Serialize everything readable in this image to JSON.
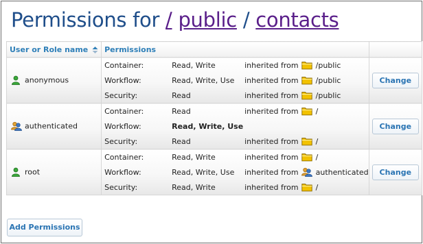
{
  "header": {
    "title_prefix": "Permissions for",
    "separator": "/",
    "crumbs": [
      "public",
      "contacts"
    ]
  },
  "table": {
    "columns": [
      "User or Role name",
      "Permissions",
      ""
    ],
    "sort_icon": "sort-arrows-icon",
    "rows": [
      {
        "user": "anonymous",
        "user_icon": "user-icon",
        "permissions": [
          {
            "kind": "Container:",
            "value": "Read, Write",
            "bold": false,
            "inherited_label": "inherited from",
            "source_icon": "folder-icon",
            "source": "/public"
          },
          {
            "kind": "Workflow:",
            "value": "Read, Write, Use",
            "bold": false,
            "inherited_label": "inherited from",
            "source_icon": "folder-icon",
            "source": "/public"
          },
          {
            "kind": "Security:",
            "value": "Read",
            "bold": false,
            "inherited_label": "inherited from",
            "source_icon": "folder-icon",
            "source": "/public"
          }
        ],
        "action": "Change"
      },
      {
        "user": "authenticated",
        "user_icon": "group-icon",
        "permissions": [
          {
            "kind": "Container:",
            "value": "Read",
            "bold": false,
            "inherited_label": "inherited from",
            "source_icon": "folder-icon",
            "source": "/"
          },
          {
            "kind": "Workflow:",
            "value": "Read, Write, Use",
            "bold": true,
            "inherited_label": "",
            "source_icon": "",
            "source": ""
          },
          {
            "kind": "Security:",
            "value": "Read",
            "bold": false,
            "inherited_label": "inherited from",
            "source_icon": "folder-icon",
            "source": "/"
          }
        ],
        "action": "Change"
      },
      {
        "user": "root",
        "user_icon": "user-icon",
        "permissions": [
          {
            "kind": "Container:",
            "value": "Read, Write",
            "bold": false,
            "inherited_label": "inherited from",
            "source_icon": "folder-icon",
            "source": "/"
          },
          {
            "kind": "Workflow:",
            "value": "Read, Write, Use",
            "bold": false,
            "inherited_label": "inherited from",
            "source_icon": "group-icon",
            "source": "authenticated"
          },
          {
            "kind": "Security:",
            "value": "Read, Write",
            "bold": false,
            "inherited_label": "inherited from",
            "source_icon": "folder-icon",
            "source": "/"
          }
        ],
        "action": "Change"
      }
    ]
  },
  "footer": {
    "add_label": "Add Permissions"
  },
  "colors": {
    "title": "#1f4e8a",
    "link": "#5a1f8a",
    "header_text": "#2e7fb8",
    "button_text": "#2a74b3",
    "folder": "#f2c200",
    "user_green": "#3aa83a",
    "group_blue": "#3f78c4"
  }
}
